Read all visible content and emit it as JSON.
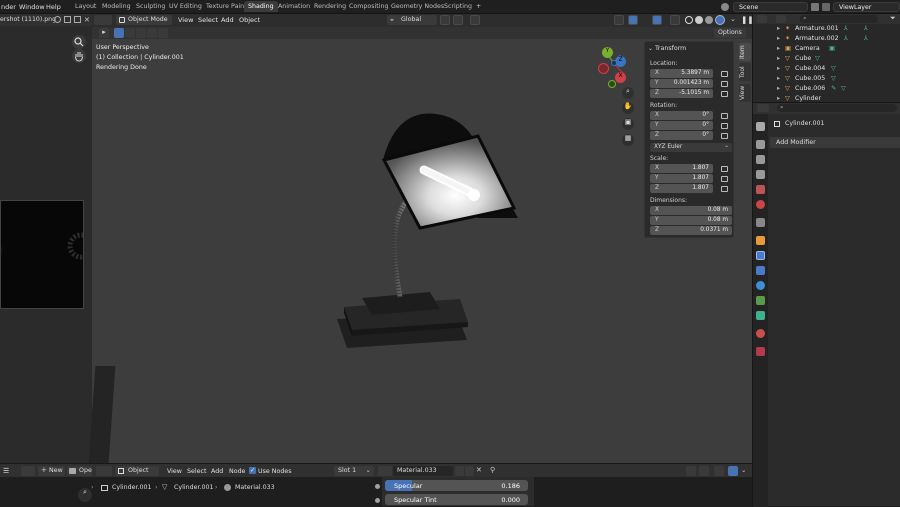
{
  "topbar": {
    "menus": [
      "nder",
      "Window",
      "Help"
    ],
    "workspaces": [
      "Layout",
      "Modeling",
      "Sculpting",
      "UV Editing",
      "Texture Paint",
      "Shading",
      "Animation",
      "Rendering",
      "Compositing",
      "Geometry Nodes",
      "Scripting"
    ],
    "active_workspace": "Shading",
    "add_tab": "+",
    "scene": "Scene",
    "view_layer": "ViewLayer"
  },
  "image_editor": {
    "file_name": "ershot (1110).png"
  },
  "viewport_header": {
    "mode": "Object Mode",
    "menus": [
      "View",
      "Select",
      "Add",
      "Object"
    ],
    "orientation": "Global",
    "options": "Options"
  },
  "viewport_overlay": {
    "line1": "User Perspective",
    "line2": "(1) Collection | Cylinder.001",
    "line3": "Rendering Done"
  },
  "gizmo": {
    "x": "X",
    "y": "Y",
    "z": "Z"
  },
  "n_panel": {
    "header": "Transform",
    "location_label": "Location:",
    "location": [
      [
        "X",
        "5.3897 m"
      ],
      [
        "Y",
        "0.001423 m"
      ],
      [
        "Z",
        "-5.1015 m"
      ]
    ],
    "rotation_label": "Rotation:",
    "rotation": [
      [
        "X",
        "0°"
      ],
      [
        "Y",
        "0°"
      ],
      [
        "Z",
        "0°"
      ]
    ],
    "rotation_mode": "XYZ Euler",
    "scale_label": "Scale:",
    "scale": [
      [
        "X",
        "1.807"
      ],
      [
        "Y",
        "1.807"
      ],
      [
        "Z",
        "1.807"
      ]
    ],
    "dimensions_label": "Dimensions:",
    "dimensions": [
      [
        "X",
        "0.08 m"
      ],
      [
        "Y",
        "0.08 m"
      ],
      [
        "Z",
        "0.0371 m"
      ]
    ]
  },
  "side_tabs": [
    "Item",
    "Tool",
    "View"
  ],
  "outliner": {
    "rows": [
      "Armature.001",
      "Armature.002",
      "Camera",
      "Cube",
      "Cube.004",
      "Cube.005",
      "Cube.006",
      "Cylinder"
    ]
  },
  "properties": {
    "object_name": "Cylinder.001",
    "add_modifier": "Add Modifier"
  },
  "shader_header": {
    "new_label": "New",
    "open_label": "Ope",
    "type": "Object",
    "menus": [
      "View",
      "Select",
      "Add",
      "Node"
    ],
    "use_nodes": "Use Nodes",
    "slot": "Slot 1",
    "material": "Material.033"
  },
  "breadcrumb": [
    "Cylinder.001",
    "Cylinder.001",
    "Material.033"
  ],
  "shader_props": {
    "specular_label": "Specular",
    "specular_value": "0.186",
    "specular_fill": 0.186,
    "specular_tint_label": "Specular Tint",
    "specular_tint_value": "0.000"
  }
}
